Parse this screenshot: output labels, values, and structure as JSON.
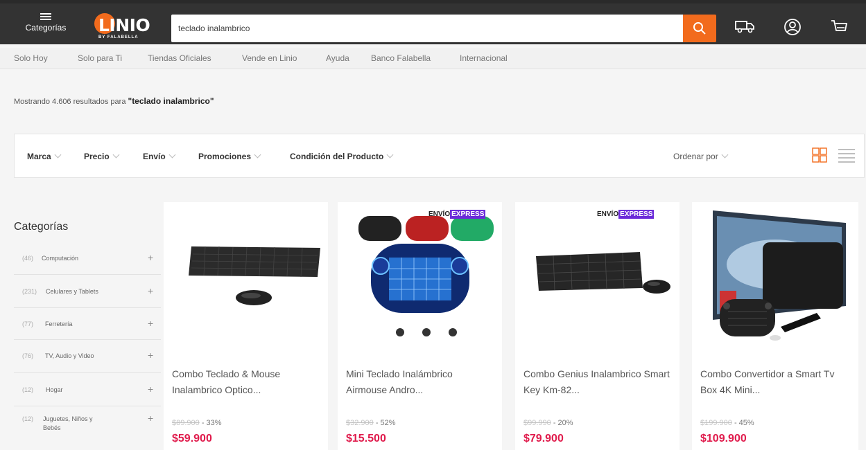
{
  "header": {
    "categories_label": "Categorías",
    "logo_text": "LINIO",
    "logo_subtext": "BY FALABELLA",
    "search_value": "teclado inalambrico",
    "icons": [
      "menu-icon",
      "search-icon",
      "shipping-truck-icon",
      "user-icon",
      "cart-icon"
    ]
  },
  "nav": {
    "links": [
      "Solo Hoy",
      "Solo para Ti",
      "Tiendas Oficiales",
      "Vende en Linio",
      "Ayuda",
      "Banco Falabella",
      "Internacional"
    ]
  },
  "results": {
    "prefix": "Mostrando 4.606 resultados para",
    "query": "\"teclado inalambrico\""
  },
  "filters": {
    "items": [
      "Marca",
      "Precio",
      "Envío",
      "Promociones",
      "Condición del Producto"
    ],
    "sort_label": "Ordenar por",
    "view_icons": [
      "grid-view-icon",
      "list-view-icon"
    ]
  },
  "sidebar": {
    "title": "Categorías",
    "items": [
      {
        "count": "(46)",
        "name": "Computación"
      },
      {
        "count": "(231)",
        "name": "Celulares y Tablets"
      },
      {
        "count": "(77)",
        "name": "Ferretería"
      },
      {
        "count": "(76)",
        "name": "TV, Audio y Video"
      },
      {
        "count": "(12)",
        "name": "Hogar"
      },
      {
        "count": "(12)",
        "name": "Juguetes, Niños y Bebés"
      }
    ]
  },
  "products": [
    {
      "title": "Combo Teclado & Mouse Inalambrico Optico...",
      "old_price": "$89.900",
      "discount": "- 33%",
      "price": "$59.900",
      "badge": false
    },
    {
      "title": "Mini Teclado Inalámbrico Airmouse Andro...",
      "old_price": "$32.900",
      "discount": "- 52%",
      "price": "$15.500",
      "badge": true
    },
    {
      "title": "Combo Genius Inalambrico Smart Key Km-82...",
      "old_price": "$99.990",
      "discount": "- 20%",
      "price": "$79.900",
      "badge": true
    },
    {
      "title": "Combo Convertidor a Smart Tv Box 4K Mini...",
      "old_price": "$199.900",
      "discount": "- 45%",
      "price": "$109.900",
      "badge": false
    }
  ],
  "badge": {
    "part1": "ENVÍO",
    "part2": "EXPRESS"
  },
  "colors": {
    "accent": "#f26b1d",
    "price": "#e01b4c",
    "header": "#333333",
    "express": "#6c2bd9"
  }
}
